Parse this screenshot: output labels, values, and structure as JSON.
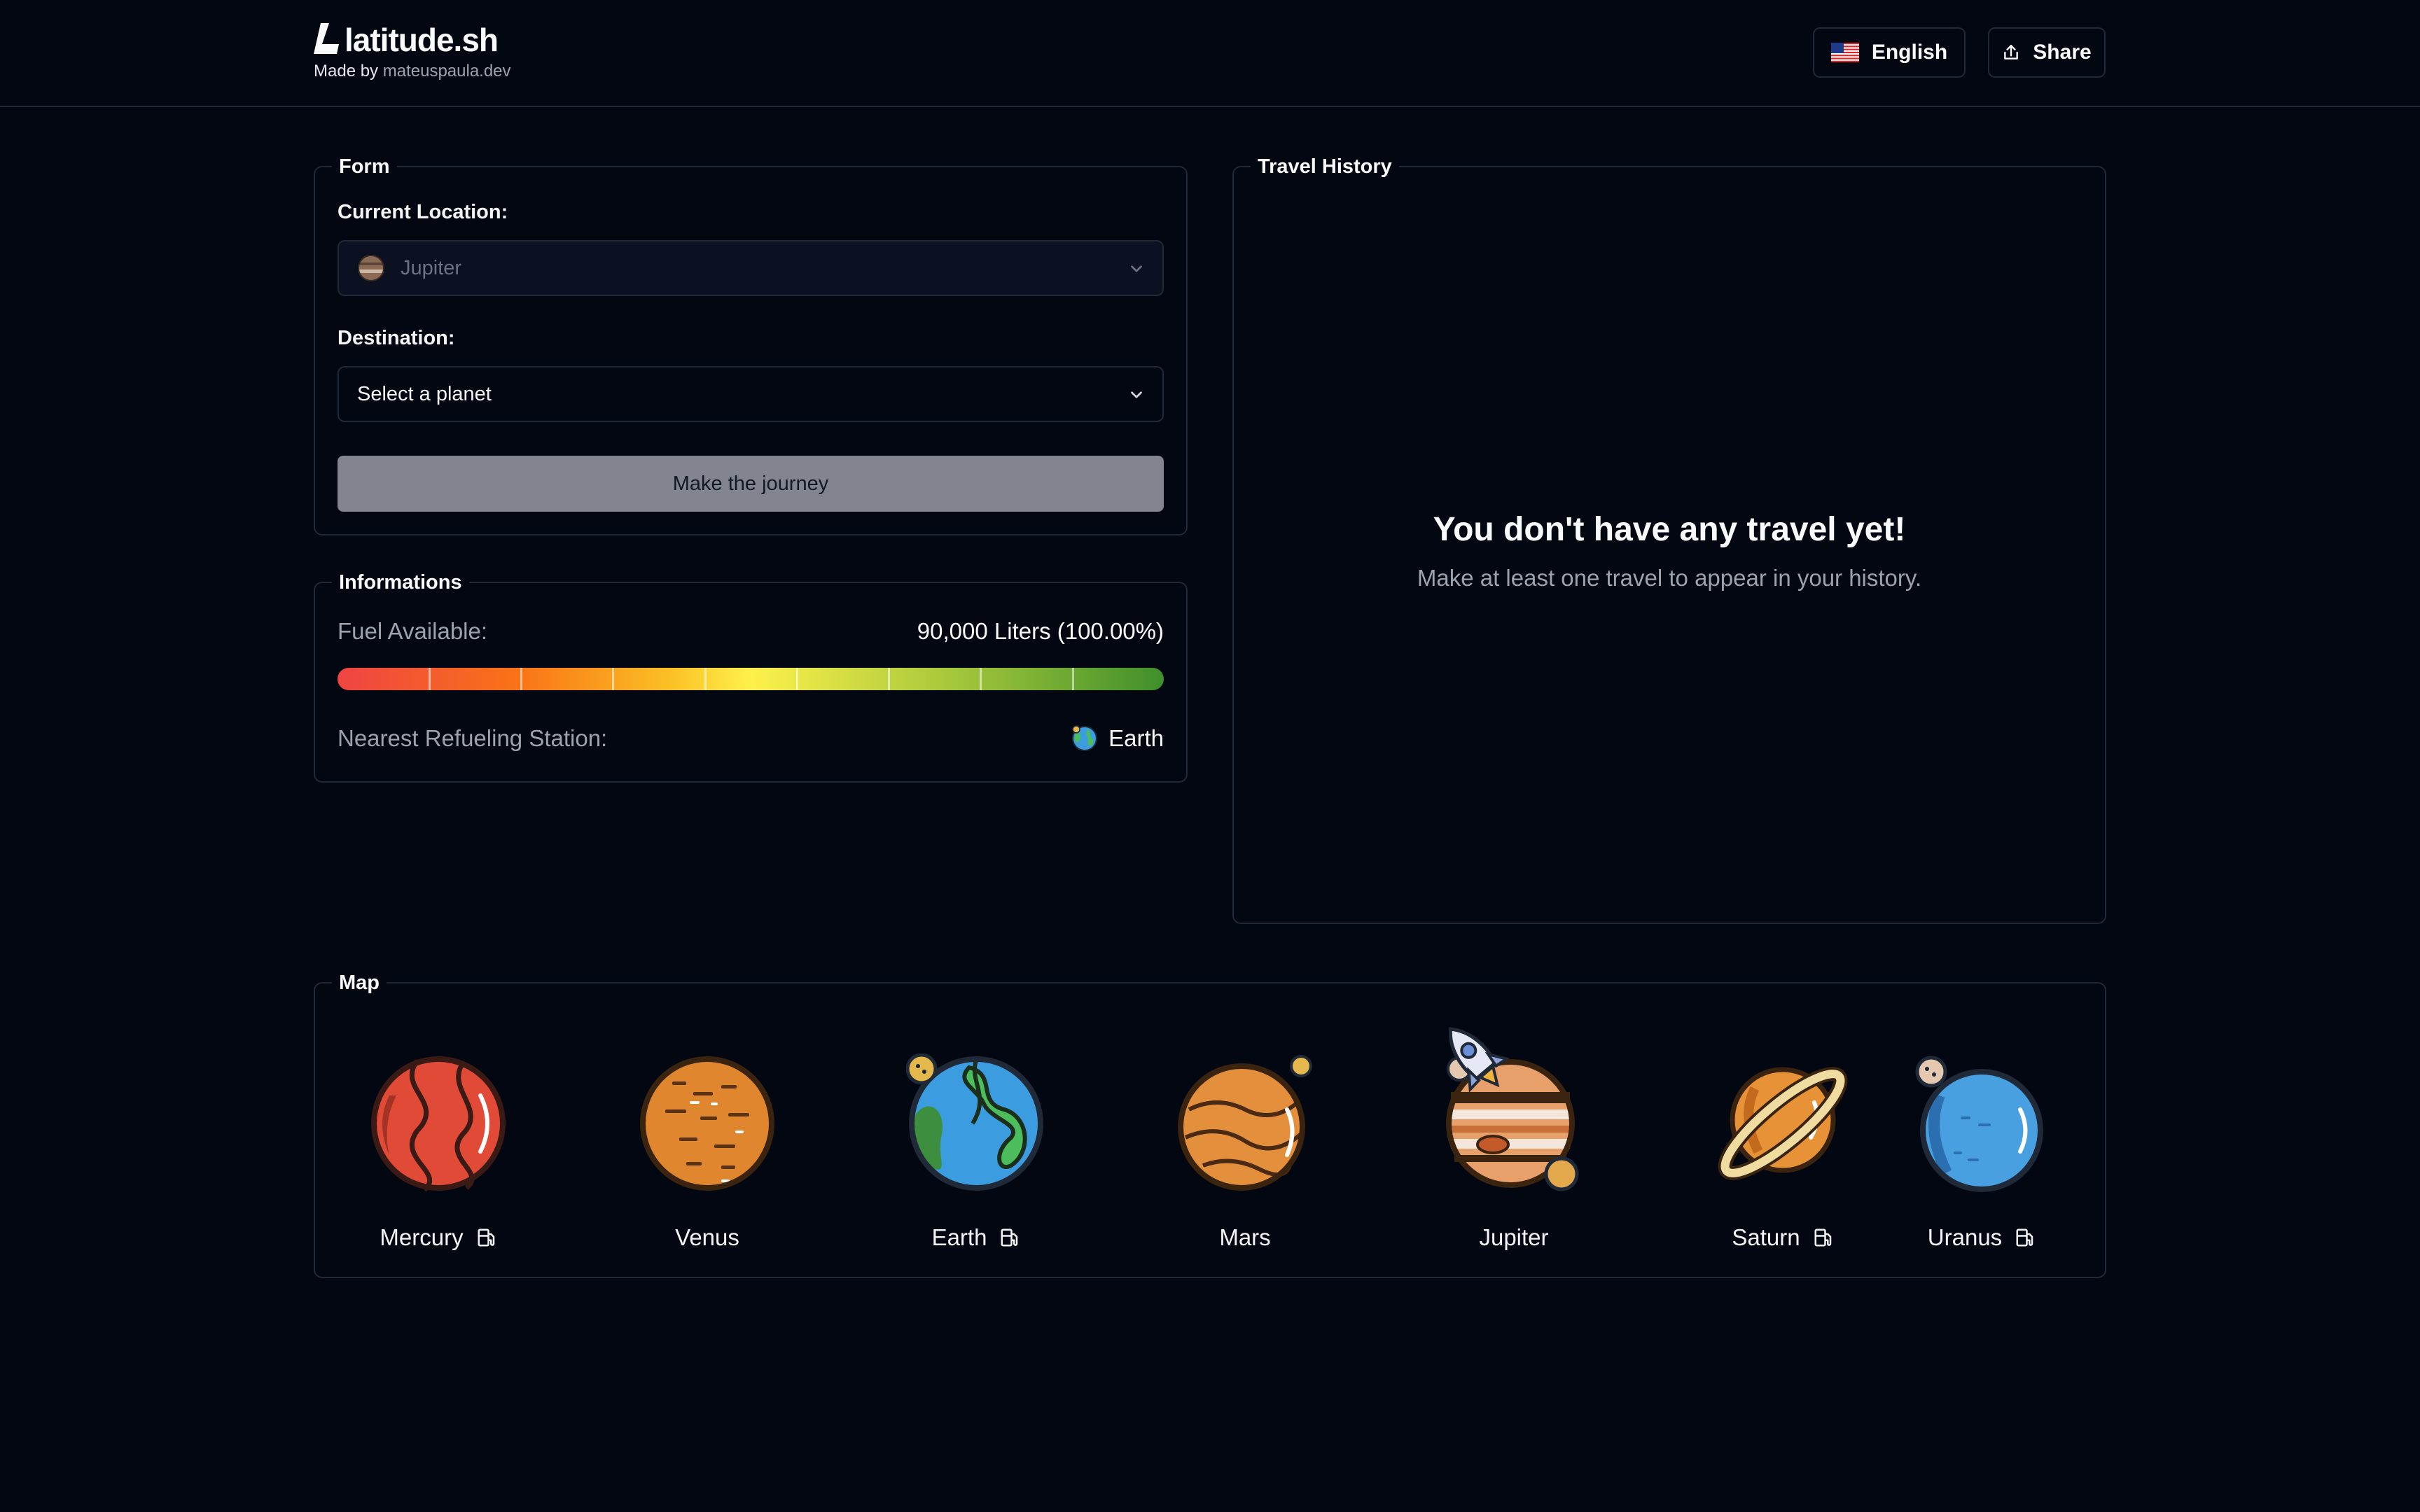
{
  "header": {
    "brand": "latitude.sh",
    "made_by_prefix": "Made by",
    "made_by_link": "mateuspaula.dev",
    "language_button": "English",
    "share_button": "Share"
  },
  "form": {
    "legend": "Form",
    "current_location_label": "Current Location:",
    "current_location_value": "Jupiter",
    "destination_label": "Destination:",
    "destination_placeholder": "Select a planet",
    "submit_label": "Make the journey"
  },
  "info": {
    "legend": "Informations",
    "fuel_label": "Fuel Available:",
    "fuel_value": "90,000 Liters (100.00%)",
    "fuel_fraction": 1.0,
    "station_label": "Nearest Refueling Station:",
    "station_value": "Earth"
  },
  "history": {
    "legend": "Travel History",
    "empty_title": "You don't have any travel yet!",
    "empty_subtitle": "Make at least one travel to appear in your history."
  },
  "map": {
    "legend": "Map",
    "current": "Jupiter",
    "planets": [
      {
        "name": "Mercury",
        "fuel_station": true,
        "icon": "mercury-icon"
      },
      {
        "name": "Venus",
        "fuel_station": false,
        "icon": "venus-icon"
      },
      {
        "name": "Earth",
        "fuel_station": true,
        "icon": "earth-icon"
      },
      {
        "name": "Mars",
        "fuel_station": false,
        "icon": "mars-icon"
      },
      {
        "name": "Jupiter",
        "fuel_station": false,
        "icon": "jupiter-icon"
      },
      {
        "name": "Saturn",
        "fuel_station": true,
        "icon": "saturn-icon"
      },
      {
        "name": "Uranus",
        "fuel_station": true,
        "icon": "uranus-icon"
      }
    ]
  },
  "colors": {
    "background": "#030712",
    "border": "#1f2937",
    "button_disabled": "#828590"
  }
}
